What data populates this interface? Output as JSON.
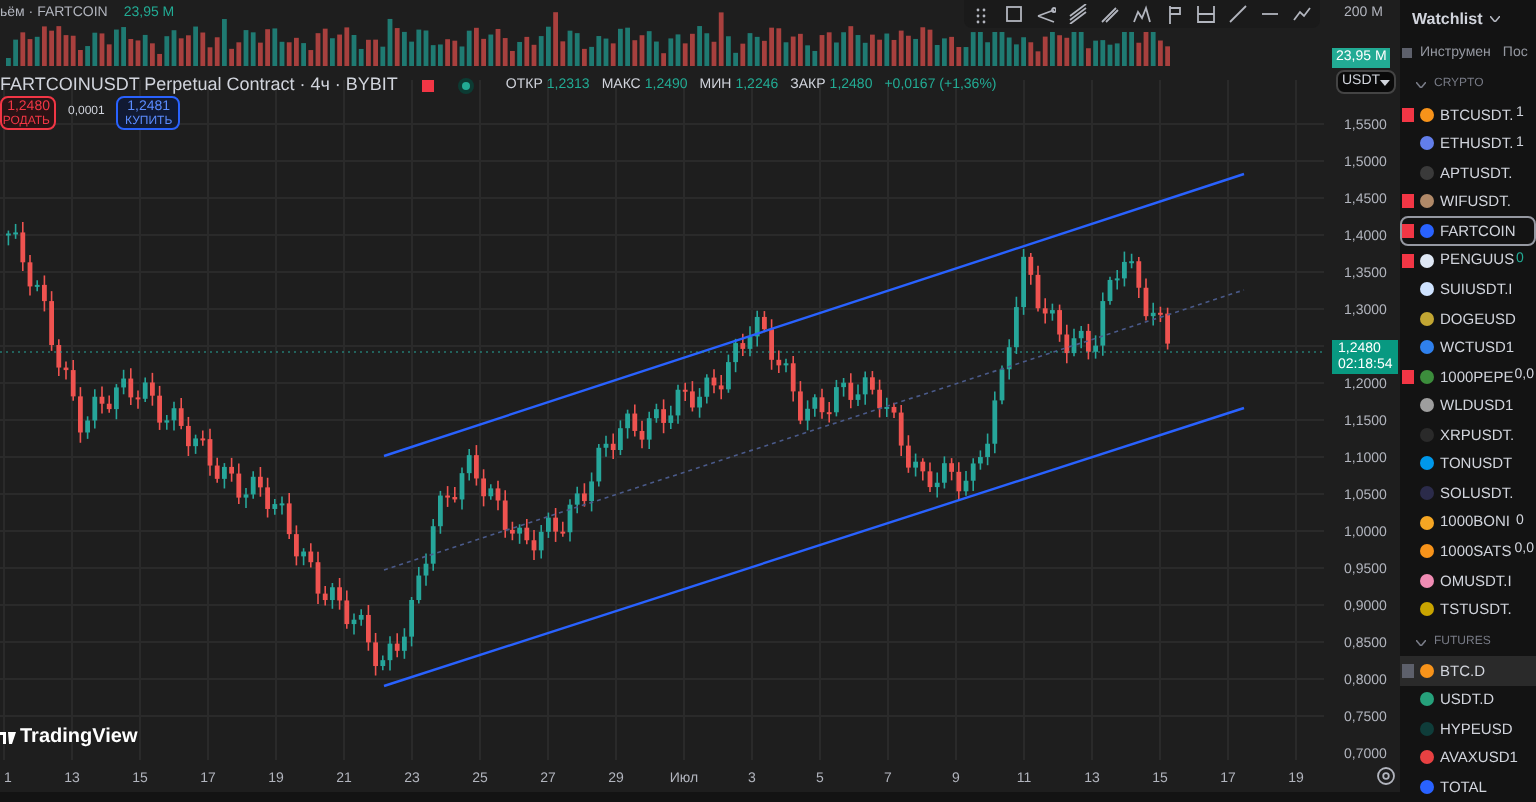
{
  "volume_legend": {
    "label": "ьём · FARTCOIN",
    "value": "23,95 M"
  },
  "symbol": {
    "title": "FARTCOINUSDT Perpetual Contract · 4ч · BYBIT",
    "ohlc": [
      {
        "label": "ОТКР",
        "value": "1,2313"
      },
      {
        "label": "МАКС",
        "value": "1,2490"
      },
      {
        "label": "МИН",
        "value": "1,2246"
      },
      {
        "label": "ЗАКР",
        "value": "1,2480"
      }
    ],
    "change": "+0,0167 (+1,36%)"
  },
  "trade": {
    "sell_price": "1,2480",
    "sell_label": "РОДАТЬ",
    "spread": "0,0001",
    "buy_price": "1,2481",
    "buy_label": "КУПИТЬ"
  },
  "price_axis": {
    "volume_top": "200 M",
    "volume_last": "23,95 M",
    "currency": "USDT",
    "ticks": [
      "1,5500",
      "1,5000",
      "1,4500",
      "1,4000",
      "1,3500",
      "1,3000",
      "1,2000",
      "1,1500",
      "1,1000",
      "1,0500",
      "1,0000",
      "0,9500",
      "0,9000",
      "0,8500",
      "0,8000",
      "0,7500",
      "0,7000"
    ],
    "last_price": "1,2480",
    "countdown": "02:18:54"
  },
  "time_axis": {
    "ticks": [
      "1",
      "13",
      "15",
      "17",
      "19",
      "21",
      "23",
      "25",
      "27",
      "29",
      "Июл",
      "3",
      "5",
      "7",
      "9",
      "11",
      "13",
      "15",
      "17",
      "19"
    ]
  },
  "logo": "TradingView",
  "watchlist": {
    "title": "Watchlist",
    "columns": [
      "Инструмен",
      "Пос"
    ],
    "sections": [
      {
        "title": "CRYPTO",
        "items": [
          {
            "symbol": "BTCUSDT.",
            "value": "1",
            "flag": {
              "color": "#f23645"
            },
            "color": "#f7931a",
            "selected": false,
            "highlighted": false
          },
          {
            "symbol": "ETHUSDT.",
            "value": "1",
            "color": "#627eea",
            "selected": false,
            "highlighted": false
          },
          {
            "symbol": "APTUSDT.",
            "color": "#3a3a3a",
            "selected": false,
            "highlighted": false
          },
          {
            "symbol": "WIFUSDT.",
            "flag": {
              "color": "#f23645"
            },
            "color": "#b08968",
            "selected": false,
            "highlighted": false
          },
          {
            "symbol": "FARTCOIN",
            "flag": {
              "color": "#f23645"
            },
            "color": "#2962ff",
            "selected": true,
            "highlighted": false
          },
          {
            "symbol": "PENGUUS",
            "value": "0",
            "flag": {
              "color": "#f23645"
            },
            "color": "#dfe8f5",
            "selected": false,
            "highlighted": false
          },
          {
            "symbol": "SUIUSDT.I",
            "color": "#cfe3ff",
            "selected": false,
            "highlighted": false
          },
          {
            "symbol": "DOGEUSD",
            "color": "#c2a633",
            "selected": false,
            "highlighted": false
          },
          {
            "symbol": "WCTUSD1",
            "color": "#2f80ed",
            "selected": false,
            "highlighted": false
          },
          {
            "symbol": "1000PEPE",
            "value": "0,0",
            "flag": {
              "color": "#f23645"
            },
            "color": "#3c8d3c",
            "selected": false,
            "highlighted": false
          },
          {
            "symbol": "WLDUSD1",
            "color": "#9e9e9e",
            "selected": false,
            "highlighted": false
          },
          {
            "symbol": "XRPUSDT.",
            "color": "#2a2a2a",
            "selected": false,
            "highlighted": false
          },
          {
            "symbol": "TONUSDT",
            "color": "#0098ea",
            "selected": false,
            "highlighted": false
          },
          {
            "symbol": "SOLUSDT.",
            "color": "#2b2b4a",
            "selected": false,
            "highlighted": false
          },
          {
            "symbol": "1000BONI",
            "value": "0",
            "color": "#f5a623",
            "selected": false,
            "highlighted": false
          },
          {
            "symbol": "1000SATS",
            "value": "0,0",
            "color": "#f7931a",
            "selected": false,
            "highlighted": false
          },
          {
            "symbol": "OMUSDT.I",
            "color": "#f08cb4",
            "selected": false,
            "highlighted": false
          },
          {
            "symbol": "TSTUSDT.",
            "color": "#c9a400",
            "selected": false,
            "highlighted": false
          }
        ]
      },
      {
        "title": "FUTURES",
        "items": [
          {
            "symbol": "BTC.D",
            "flag": {
              "color": "#5d606b"
            },
            "color": "#f7931a",
            "selected": false,
            "highlighted": true
          },
          {
            "symbol": "USDT.D",
            "color": "#26a17b",
            "selected": false,
            "highlighted": false
          },
          {
            "symbol": "HYPEUSD",
            "color": "#0f3d3a",
            "selected": false,
            "highlighted": false
          },
          {
            "symbol": "AVAXUSD1",
            "color": "#e84142",
            "selected": false,
            "highlighted": false
          },
          {
            "symbol": "TOTAL",
            "color": "#2962ff",
            "selected": false,
            "highlighted": false
          }
        ]
      }
    ]
  }
}
